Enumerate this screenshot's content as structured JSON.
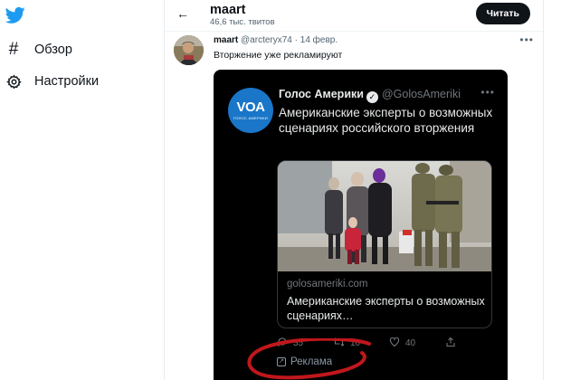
{
  "sidebar": {
    "logo_icon": "twitter-bird-icon",
    "items": [
      {
        "icon": "hashtag-icon",
        "label": "Обзор"
      },
      {
        "icon": "gear-icon",
        "label": "Настройки"
      }
    ]
  },
  "header": {
    "back_icon": "arrow-left-icon",
    "name": "maart",
    "tweet_count": "46,6 тыс. твитов",
    "follow_label": "Читать"
  },
  "tweet": {
    "author_name": "maart",
    "handle": "@arcteryx74",
    "separator": "·",
    "date": "14 февр.",
    "text": "Вторжение уже рекламируют",
    "more_icon": "more-horizontal-icon"
  },
  "embedded_tweet": {
    "avatar_text": "VOA",
    "avatar_subtext": "ГОЛОС АМЕРИКИ",
    "name": "Голос Америки",
    "handle": "@GolosAmeriki",
    "verified_icon": "verified-badge-icon",
    "text": "Американские эксперты о возможных сценариях российского вторжения",
    "card": {
      "domain": "golosameriki.com",
      "title": "Американские эксперты о возможных сценариях…"
    },
    "actions": {
      "reply_count": "35",
      "retweet_count": "10",
      "like_count": "40"
    },
    "promoted_label": "Реклама"
  },
  "colors": {
    "twitter_blue": "#1d9bf0",
    "embed_bg": "#000000",
    "voa_blue": "#1a76c8",
    "annotation_red": "#c0171c"
  }
}
